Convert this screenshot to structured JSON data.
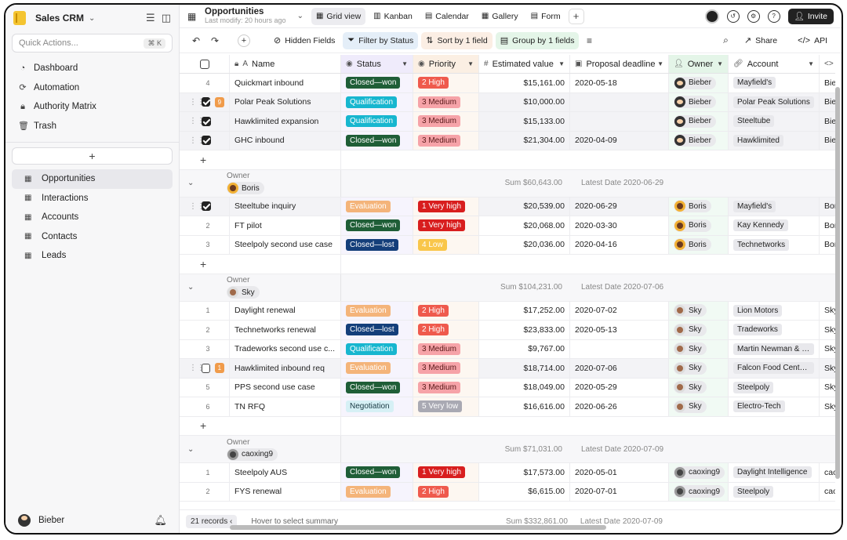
{
  "sidebar": {
    "brand": "Sales CRM",
    "quick_actions": "Quick Actions...",
    "quick_shortcut": "⌘ K",
    "nav": [
      {
        "label": "Dashboard",
        "icon": "gauge-icon"
      },
      {
        "label": "Automation",
        "icon": "automation-icon"
      },
      {
        "label": "Authority Matrix",
        "icon": "lock-icon"
      },
      {
        "label": "Trash",
        "icon": "trash-icon"
      }
    ],
    "add_label": "+",
    "tables": [
      {
        "label": "Opportunities",
        "active": true
      },
      {
        "label": "Interactions",
        "active": false
      },
      {
        "label": "Accounts",
        "active": false
      },
      {
        "label": "Contacts",
        "active": false
      },
      {
        "label": "Leads",
        "active": false
      }
    ],
    "user": "Bieber"
  },
  "topbar": {
    "title": "Opportunities",
    "subtitle": "Last modify: 20 hours ago",
    "views": [
      {
        "label": "Grid view",
        "icon": "▦",
        "active": true
      },
      {
        "label": "Kanban",
        "icon": "▥",
        "active": false
      },
      {
        "label": "Calendar",
        "icon": "▤",
        "active": false
      },
      {
        "label": "Gallery",
        "icon": "▦",
        "active": false
      },
      {
        "label": "Form",
        "icon": "▤",
        "active": false
      }
    ],
    "add_view": "+",
    "invite": "Invite"
  },
  "toolbar": {
    "hidden_fields": "Hidden Fields",
    "filter": "Filter by Status",
    "sort": "Sort by 1 field",
    "group": "Group by 1 fields",
    "share": "Share",
    "api": "API"
  },
  "columns": {
    "name": "Name",
    "status": "Status",
    "priority": "Priority",
    "value": "Estimated value",
    "deadline": "Proposal deadline",
    "owner": "Owner",
    "account": "Account",
    "owner2": "Ow"
  },
  "colors": {
    "Closed—won": "#1f5e37",
    "Closed—lost": "#143f7a",
    "Qualification": "#17b6cf",
    "Evaluation": "#f4b47a",
    "Negotiation": "#d6f0f5",
    "1 Very high": "#d81e1e",
    "2 High": "#ef5a4d",
    "3 Medium": "#f6a3a8",
    "4 Low": "#f9c64a",
    "5 Very low": "#a9a9b3"
  },
  "top_rows": [
    {
      "num": "4",
      "mode": "num",
      "name": "Quickmart inbound",
      "status": "Closed—won",
      "priority": "2 High",
      "value": "$15,161.00",
      "date": "2020-05-18",
      "owner": "Bieber",
      "account": "Mayfield's",
      "owner2": "Biebe"
    },
    {
      "num": "9",
      "mode": "checked-count",
      "name": "Polar Peak Solutions",
      "status": "Qualification",
      "priority": "3 Medium",
      "value": "$10,000.00",
      "date": "",
      "owner": "Bieber",
      "account": "Polar Peak Solutions",
      "owner2": "Biebe"
    },
    {
      "num": "",
      "mode": "checked",
      "name": "Hawklimited expansion",
      "status": "Qualification",
      "priority": "3 Medium",
      "value": "$15,133.00",
      "date": "",
      "owner": "Bieber",
      "account": "Steeltube",
      "owner2": "Biebe"
    },
    {
      "num": "",
      "mode": "checked",
      "name": "GHC inbound",
      "status": "Closed—won",
      "priority": "3 Medium",
      "value": "$21,304.00",
      "date": "2020-04-09",
      "owner": "Bieber",
      "account": "Hawklimited",
      "owner2": "Biebe"
    }
  ],
  "groups": [
    {
      "label": "Owner",
      "owner": "Boris",
      "sum": "Sum $60,643.00",
      "latest": "Latest Date 2020-06-29",
      "rows": [
        {
          "num": "",
          "mode": "checked",
          "name": "Steeltube inquiry",
          "status": "Evaluation",
          "priority": "1 Very high",
          "value": "$20,539.00",
          "date": "2020-06-29",
          "owner": "Boris",
          "account": "Mayfield's",
          "owner2": "Boris"
        },
        {
          "num": "2",
          "mode": "num",
          "name": "FT pilot",
          "status": "Closed—won",
          "priority": "1 Very high",
          "value": "$20,068.00",
          "date": "2020-03-30",
          "owner": "Boris",
          "account": "Kay Kennedy",
          "owner2": "Boris"
        },
        {
          "num": "3",
          "mode": "num",
          "name": "Steelpoly second use case",
          "status": "Closed—lost",
          "priority": "4 Low",
          "value": "$20,036.00",
          "date": "2020-04-16",
          "owner": "Boris",
          "account": "Technetworks",
          "owner2": "Boris"
        }
      ]
    },
    {
      "label": "Owner",
      "owner": "Sky",
      "sum": "Sum $104,231.00",
      "latest": "Latest Date 2020-07-06",
      "rows": [
        {
          "num": "1",
          "mode": "num",
          "name": "Daylight renewal",
          "status": "Evaluation",
          "priority": "2 High",
          "value": "$17,252.00",
          "date": "2020-07-02",
          "owner": "Sky",
          "account": "Lion Motors",
          "owner2": "Sky"
        },
        {
          "num": "2",
          "mode": "num",
          "name": "Technetworks renewal",
          "status": "Closed—lost",
          "priority": "2 High",
          "value": "$23,833.00",
          "date": "2020-05-13",
          "owner": "Sky",
          "account": "Tradeworks",
          "owner2": "Sky"
        },
        {
          "num": "3",
          "mode": "num",
          "name": "Tradeworks second use c...",
          "status": "Qualification",
          "priority": "3 Medium",
          "value": "$9,767.00",
          "date": "",
          "owner": "Sky",
          "account": "Martin Newman & S...",
          "owner2": "Sky"
        },
        {
          "num": "1",
          "mode": "unchecked-count",
          "name": "Hawklimited inbound req",
          "status": "Evaluation",
          "priority": "3 Medium",
          "value": "$18,714.00",
          "date": "2020-07-06",
          "owner": "Sky",
          "account": "Falcon Food Centers",
          "owner2": "Sky"
        },
        {
          "num": "5",
          "mode": "num",
          "name": "PPS second use case",
          "status": "Closed—won",
          "priority": "3 Medium",
          "value": "$18,049.00",
          "date": "2020-05-29",
          "owner": "Sky",
          "account": "Steelpoly",
          "owner2": "Sky"
        },
        {
          "num": "6",
          "mode": "num",
          "name": "TN RFQ",
          "status": "Negotiation",
          "priority": "5 Very low",
          "value": "$16,616.00",
          "date": "2020-06-26",
          "owner": "Sky",
          "account": "Electro-Tech",
          "owner2": "Sky"
        }
      ]
    },
    {
      "label": "Owner",
      "owner": "caoxing9",
      "sum": "Sum $71,031.00",
      "latest": "Latest Date 2020-07-09",
      "rows": [
        {
          "num": "1",
          "mode": "num",
          "name": "Steelpoly AUS",
          "status": "Closed—won",
          "priority": "1 Very high",
          "value": "$17,573.00",
          "date": "2020-05-01",
          "owner": "caoxing9",
          "account": "Daylight Intelligence",
          "owner2": "caoxi"
        },
        {
          "num": "2",
          "mode": "num",
          "name": "FYS renewal",
          "status": "Evaluation",
          "priority": "2 High",
          "value": "$6,615.00",
          "date": "2020-07-01",
          "owner": "caoxing9",
          "account": "Steelpoly",
          "owner2": "caoxi"
        }
      ]
    }
  ],
  "footer": {
    "records": "21 records",
    "hover": "Hover to select summary",
    "sum": "Sum $332,861.00",
    "latest": "Latest Date 2020-07-09"
  }
}
